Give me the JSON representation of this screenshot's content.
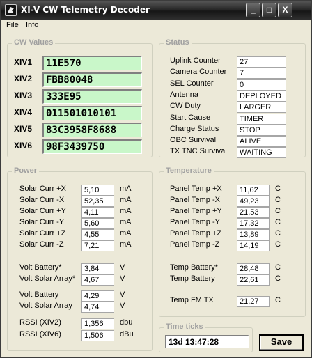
{
  "window": {
    "title": "XI-V CW Telemetry Decoder",
    "minimize": "_",
    "maximize": "□",
    "close": "X"
  },
  "menu": [
    "File",
    "Info"
  ],
  "cw": {
    "label": "CW Values",
    "rows": [
      {
        "name": "XIV1",
        "value": "11E570"
      },
      {
        "name": "XIV2",
        "value": "FBB80048"
      },
      {
        "name": "XIV3",
        "value": "333E95"
      },
      {
        "name": "XIV4",
        "value": "011501010101"
      },
      {
        "name": "XIV5",
        "value": "83C3958F8688"
      },
      {
        "name": "XIV6",
        "value": "98F3439750"
      }
    ]
  },
  "status": {
    "label": "Status",
    "rows": [
      {
        "name": "Uplink Counter",
        "value": "27"
      },
      {
        "name": "Camera Counter",
        "value": "7"
      },
      {
        "name": "SEL Counter",
        "value": "0"
      },
      {
        "name": "Antenna",
        "value": "DEPLOYED"
      },
      {
        "name": "CW Duty",
        "value": "LARGER"
      },
      {
        "name": "Start Cause",
        "value": "TIMER"
      },
      {
        "name": "Charge Status",
        "value": "STOP"
      },
      {
        "name": "OBC Survival",
        "value": "ALIVE"
      },
      {
        "name": "TX TNC Survival",
        "value": "WAITING"
      }
    ]
  },
  "power": {
    "label": "Power",
    "rows": [
      {
        "name": "Solar Curr +X",
        "value": "5,10",
        "unit": "mA"
      },
      {
        "name": "Solar Curr -X",
        "value": "52,35",
        "unit": "mA"
      },
      {
        "name": "Solar Curr +Y",
        "value": "4,11",
        "unit": "mA"
      },
      {
        "name": "Solar Curr -Y",
        "value": "5,60",
        "unit": "mA"
      },
      {
        "name": "Solar Curr +Z",
        "value": "4,55",
        "unit": "mA"
      },
      {
        "name": "Solar Curr -Z",
        "value": "7,21",
        "unit": "mA"
      },
      {
        "name": "Volt Battery*",
        "value": "3,84",
        "unit": "V"
      },
      {
        "name": "Volt Solar Array*",
        "value": "4,67",
        "unit": "V"
      },
      {
        "name": "Volt Battery",
        "value": "4,29",
        "unit": "V"
      },
      {
        "name": "Volt Solar Array",
        "value": "4,74",
        "unit": "V"
      },
      {
        "name": "RSSI (XIV2)",
        "value": "1,356",
        "unit": "dbu"
      },
      {
        "name": "RSSI (XIV6)",
        "value": "1,506",
        "unit": "dBu"
      }
    ]
  },
  "temperature": {
    "label": "Temperature",
    "rows": [
      {
        "name": "Panel Temp +X",
        "value": "11,62",
        "unit": "C"
      },
      {
        "name": "Panel Temp -X",
        "value": "49,23",
        "unit": "C"
      },
      {
        "name": "Panel Temp +Y",
        "value": "21,53",
        "unit": "C"
      },
      {
        "name": "Panel Temp -Y",
        "value": "17,32",
        "unit": "C"
      },
      {
        "name": "Panel Temp +Z",
        "value": "13,89",
        "unit": "C"
      },
      {
        "name": "Panel Temp -Z",
        "value": "14,19",
        "unit": "C"
      },
      {
        "name": "Temp Battery*",
        "value": "28,48",
        "unit": "C"
      },
      {
        "name": "Temp Battery",
        "value": "22,61",
        "unit": "C"
      },
      {
        "name": "Temp FM TX",
        "value": "21,27",
        "unit": "C"
      }
    ]
  },
  "time_ticks": {
    "label": "Time ticks",
    "value": "13d 13:47:28"
  },
  "save_label": "Save"
}
